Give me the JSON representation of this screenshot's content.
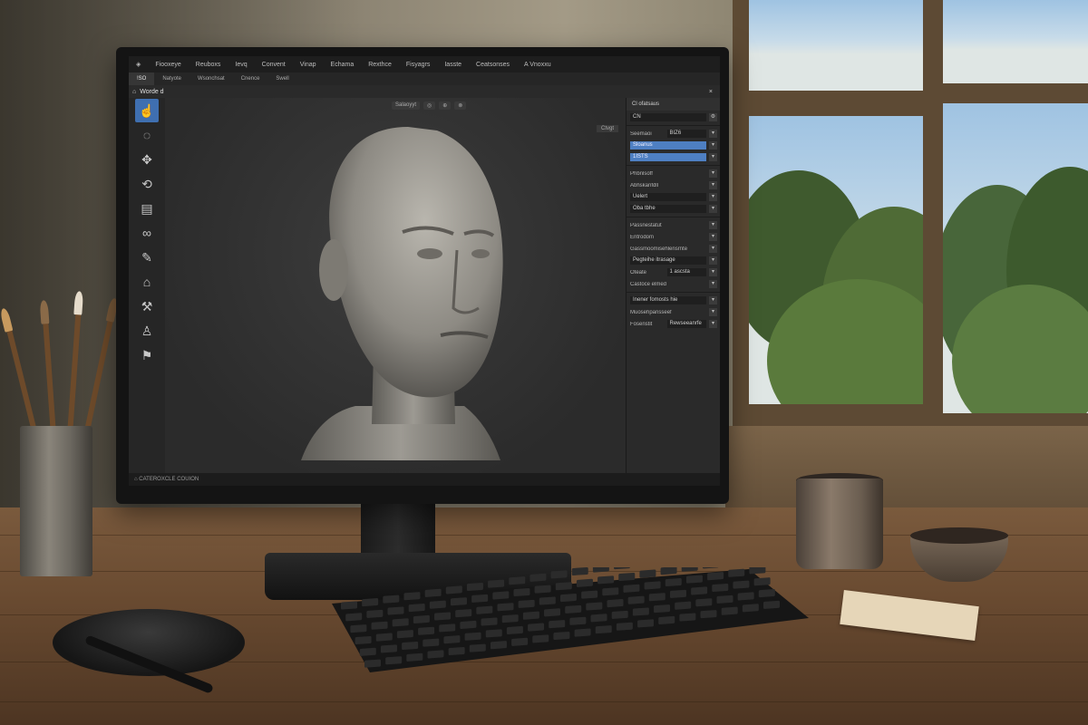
{
  "app": {
    "menus": [
      "Fiooxeye",
      "Reuboxs",
      "Ievq",
      "Convent",
      "Vinap",
      "Echama",
      "Rexthce",
      "Fisyagrs",
      "Iasste",
      "Ceatsonses",
      "A Vnoxxu"
    ],
    "tabs": [
      "!SO",
      "Natyote",
      "Wsonchsat",
      "Cnence",
      "Swell"
    ],
    "doc_title": "Worde d",
    "doc_close": "×",
    "viewport_chips": [
      "Salaoyyt",
      "◎",
      "⊕",
      "⊗"
    ],
    "viewport_corner": "Ctvgt",
    "status": "⌂  CATEROXCLE COUION"
  },
  "toolbar": {
    "tools": [
      {
        "icon": "hand-pointer-icon",
        "glyph": "☝",
        "active": true
      },
      {
        "icon": "lasso-circle-icon",
        "glyph": "◌",
        "active": false
      },
      {
        "icon": "move-arrows-icon",
        "glyph": "✥",
        "active": false
      },
      {
        "icon": "rotate-icon",
        "glyph": "⟲",
        "active": false
      },
      {
        "icon": "layers-icon",
        "glyph": "▤",
        "active": false
      },
      {
        "icon": "link-icon",
        "glyph": "∞",
        "active": false
      },
      {
        "icon": "brush-icon",
        "glyph": "✎",
        "active": false
      },
      {
        "icon": "sculpt-icon",
        "glyph": "⌂",
        "active": false
      },
      {
        "icon": "clay-icon",
        "glyph": "⚒",
        "active": false
      },
      {
        "icon": "figure-icon",
        "glyph": "♙",
        "active": false
      },
      {
        "icon": "tool-misc-icon",
        "glyph": "⚑",
        "active": false
      }
    ]
  },
  "panel": {
    "title": "Cl ofatsaus",
    "search": "CN",
    "rows": [
      {
        "label": "Seemaoi",
        "value": "BIZ6",
        "blue": false
      },
      {
        "label": "",
        "value": "Sloanus",
        "blue": true
      },
      {
        "label": "",
        "value": "1ISTS",
        "blue": true
      },
      {
        "label": "Phbnlsoff",
        "value": "",
        "blue": false
      },
      {
        "label": "Abhskanfdll",
        "value": "",
        "blue": false
      },
      {
        "label": "",
        "value": "Uelert",
        "blue": false
      },
      {
        "label": "",
        "value": "Oba  tbhe",
        "blue": false
      },
      {
        "label": "Passnestatut",
        "value": "",
        "blue": false
      },
      {
        "label": "Entrodom",
        "value": "",
        "blue": false
      },
      {
        "label": "Gassmoomisehlensrnte",
        "value": "",
        "blue": false
      },
      {
        "label": "",
        "value": "Pegteihe itrasage",
        "blue": false
      },
      {
        "label": "Oteate",
        "value": "1 ascsta",
        "blue": false
      },
      {
        "label": "Castoce elmed",
        "value": "",
        "blue": false
      },
      {
        "label": "",
        "value": "Inener fomosts hie",
        "blue": false
      },
      {
        "label": "Muosehpansseef",
        "value": "",
        "blue": false
      },
      {
        "label": "Fosenstit",
        "value": "Rewseeanrfe",
        "blue": false
      }
    ]
  },
  "colors": {
    "accent": "#4e7fc2",
    "bg": "#2f2f2f"
  }
}
